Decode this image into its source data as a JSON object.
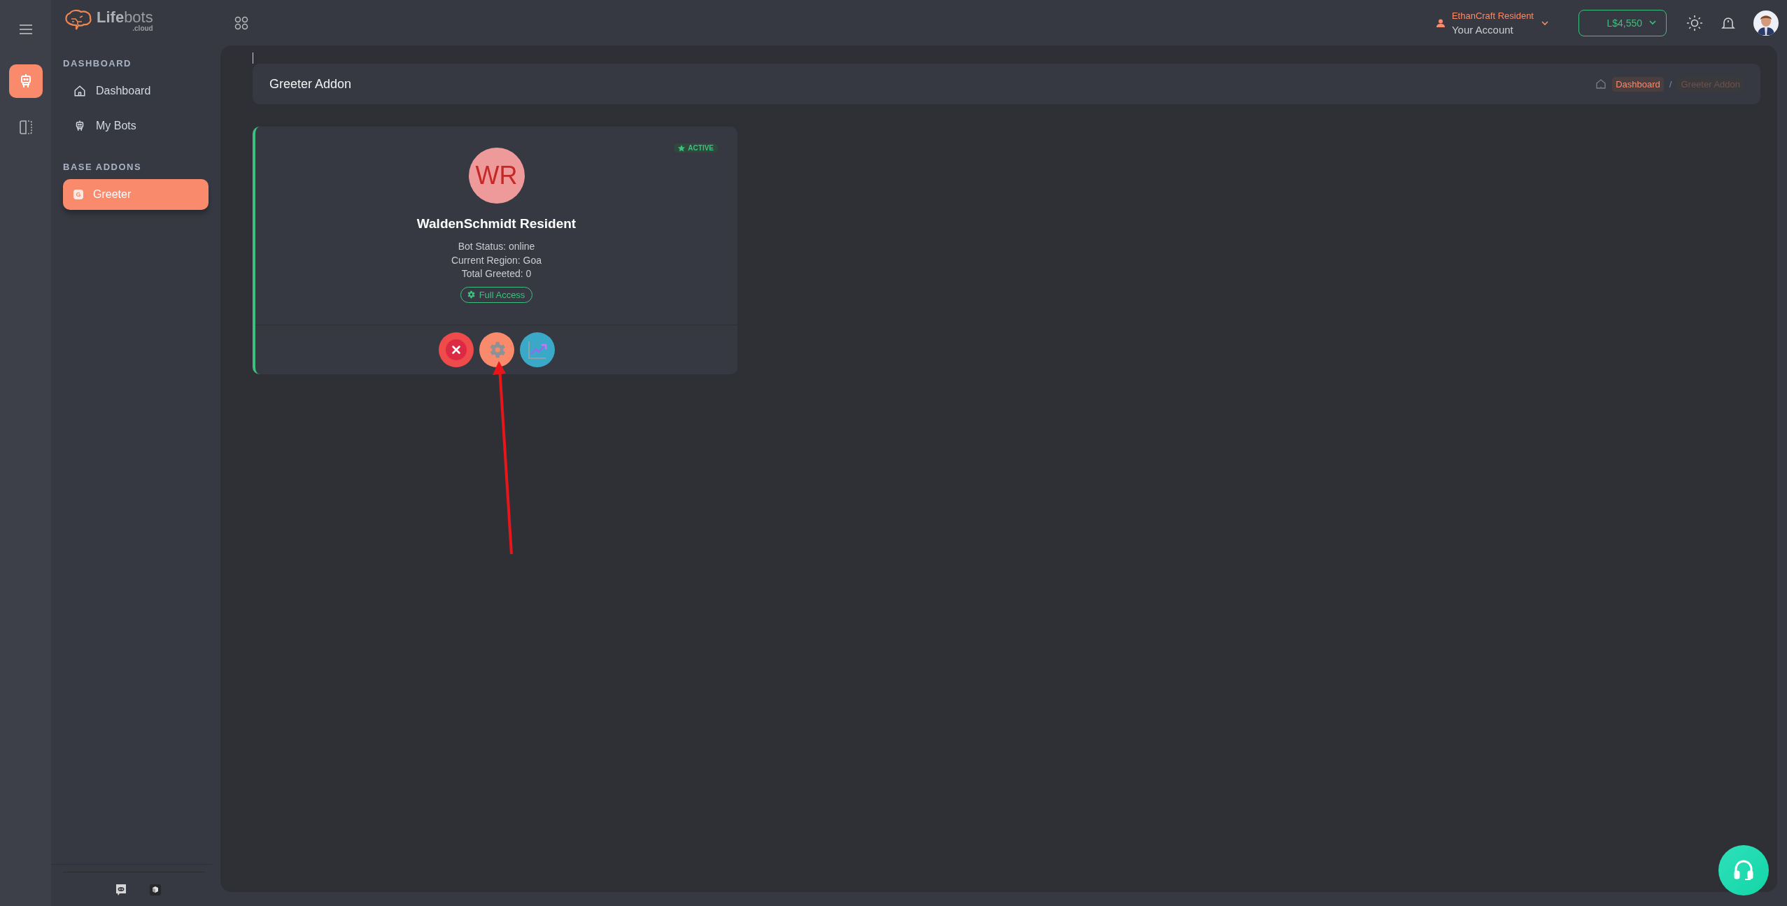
{
  "rail": {
    "items": [
      {
        "kind": "bots",
        "selected": true
      },
      {
        "kind": "panel",
        "selected": false
      }
    ]
  },
  "sidebar": {
    "logo": {
      "name": "**Life**bots",
      "suffix": ".cloud"
    },
    "sections": [
      {
        "title": "DASHBOARD",
        "items": [
          {
            "label": "Dashboard",
            "kind": "home",
            "selected": false
          },
          {
            "label": "My Bots",
            "kind": "robot",
            "selected": false
          }
        ]
      },
      {
        "title": "BASE ADDONS",
        "items": [
          {
            "label": "Greeter",
            "kind": "letter",
            "badge": "G",
            "selected": true
          }
        ]
      }
    ],
    "footer": [
      {
        "kind": "chat"
      },
      {
        "kind": "cube"
      }
    ]
  },
  "header": {
    "account": {
      "name": "EthanCraft Resident",
      "subtitle": "Your Account"
    },
    "balance": "L$4,550"
  },
  "page": {
    "title": "Greeter Addon",
    "breadcrumb": [
      {
        "label": "Dashboard",
        "current": false
      },
      {
        "label": "Greeter Addon",
        "current": true
      }
    ],
    "separator": "/"
  },
  "bot_card": {
    "status_badge": "ACTIVE",
    "initials": "WR",
    "name": "WaldenSchmidt Resident",
    "details": [
      "Bot Status: online",
      "Current Region: Goa",
      "Total Greeted: 0"
    ],
    "access": "Full Access",
    "actions": [
      {
        "kind": "stop"
      },
      {
        "kind": "settings"
      },
      {
        "kind": "stats"
      }
    ]
  }
}
